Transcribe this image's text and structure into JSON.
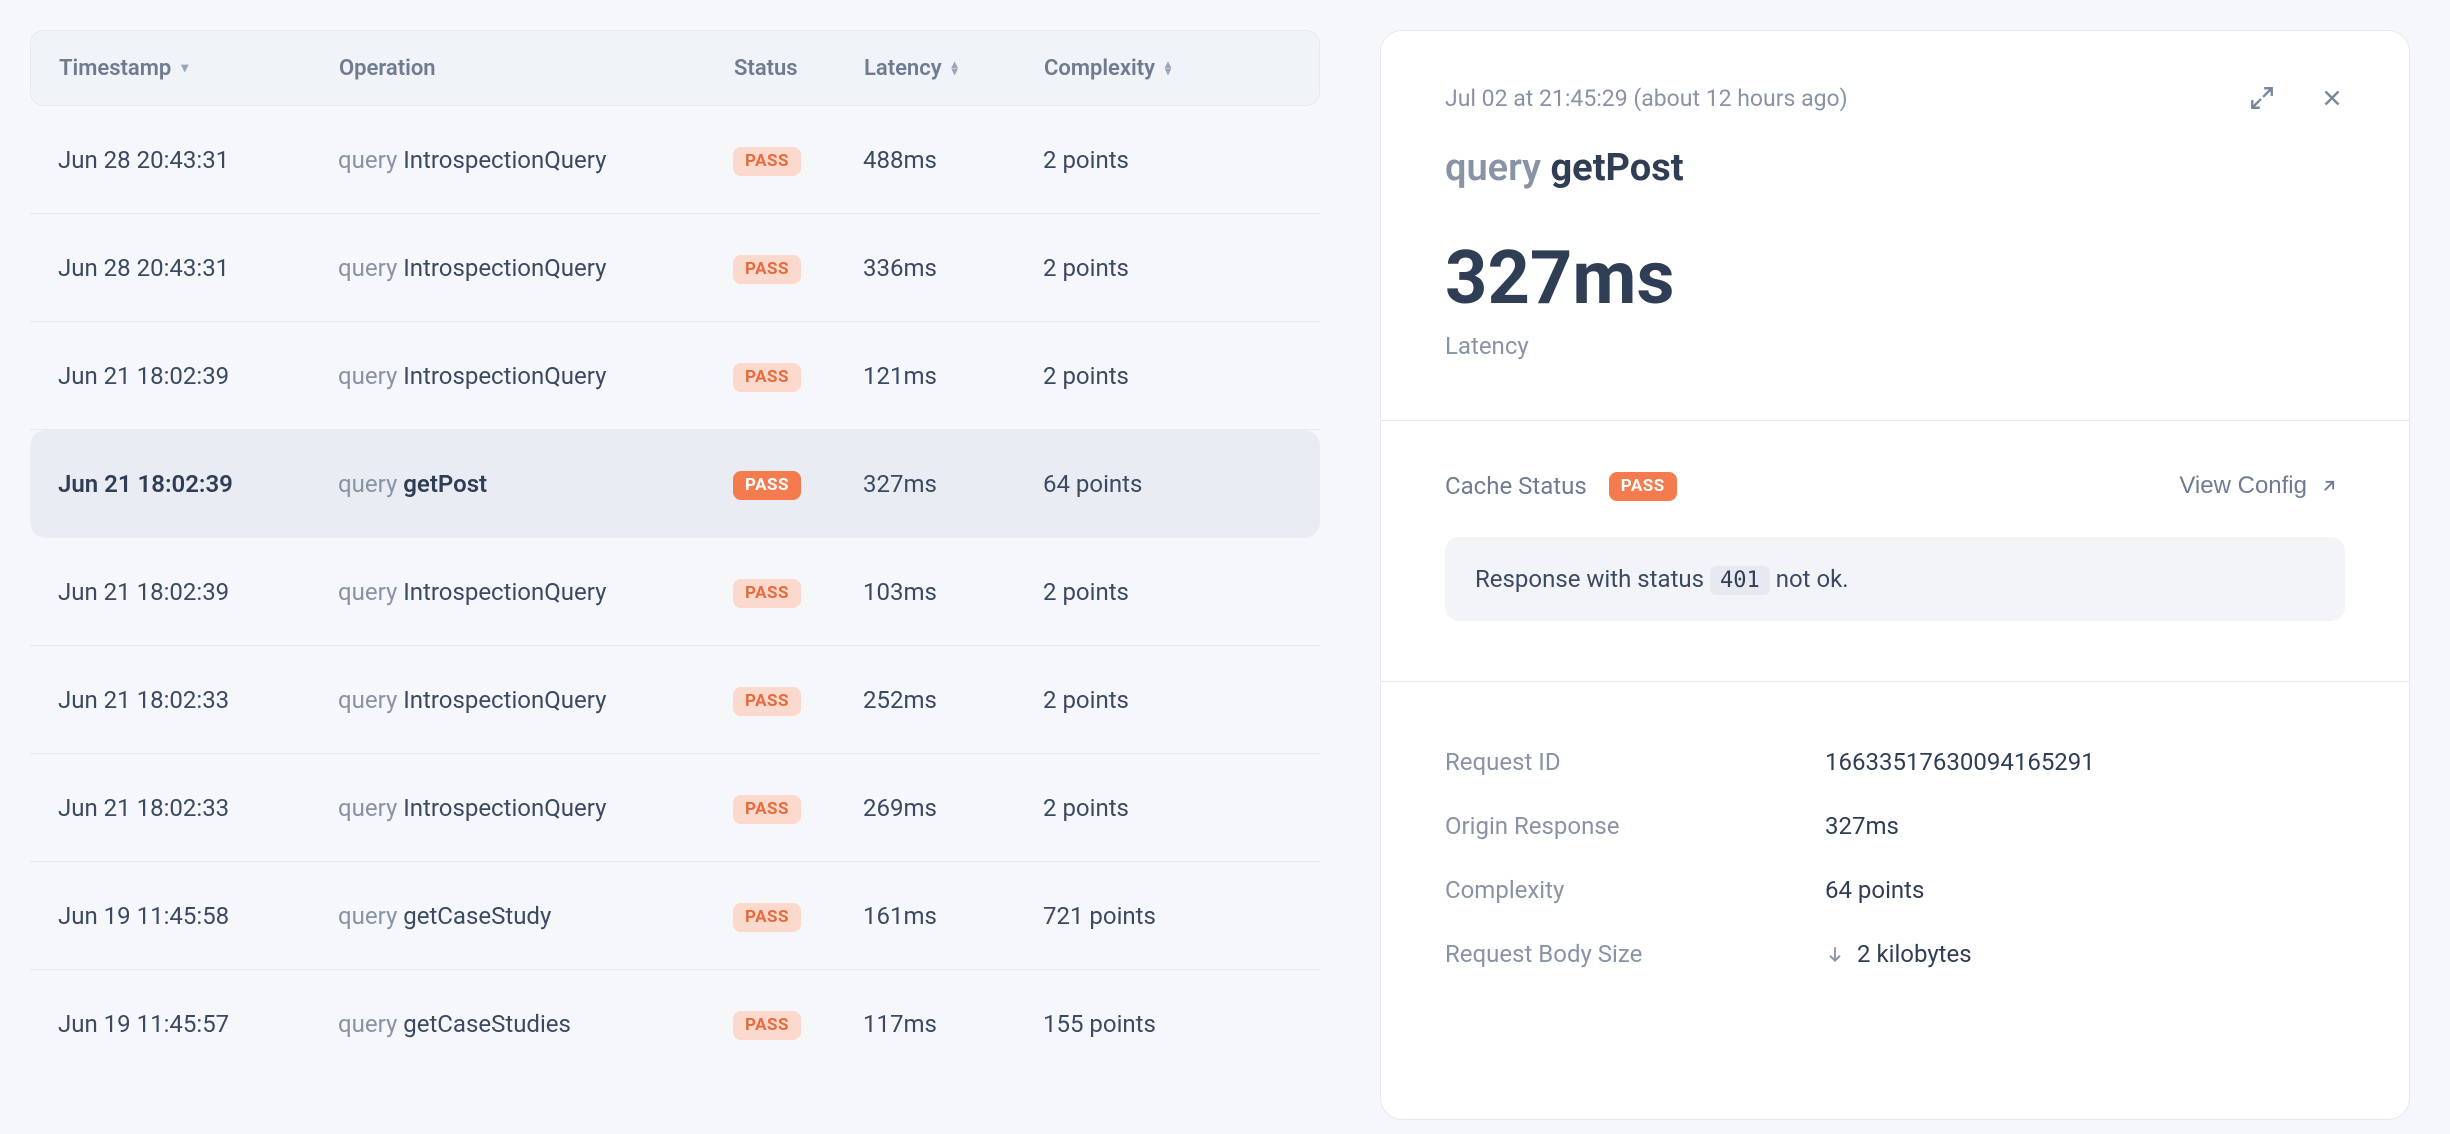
{
  "table": {
    "headers": {
      "timestamp": "Timestamp",
      "operation": "Operation",
      "status": "Status",
      "latency": "Latency",
      "complexity": "Complexity"
    },
    "rows": [
      {
        "ts": "Jun 28 20:43:31",
        "op_type": "query",
        "op_name": "IntrospectionQuery",
        "status": "PASS",
        "status_style": "light",
        "latency": "488ms",
        "complexity": "2 points",
        "selected": false
      },
      {
        "ts": "Jun 28 20:43:31",
        "op_type": "query",
        "op_name": "IntrospectionQuery",
        "status": "PASS",
        "status_style": "light",
        "latency": "336ms",
        "complexity": "2 points",
        "selected": false
      },
      {
        "ts": "Jun 21 18:02:39",
        "op_type": "query",
        "op_name": "IntrospectionQuery",
        "status": "PASS",
        "status_style": "light",
        "latency": "121ms",
        "complexity": "2 points",
        "selected": false
      },
      {
        "ts": "Jun 21 18:02:39",
        "op_type": "query",
        "op_name": "getPost",
        "status": "PASS",
        "status_style": "solid",
        "latency": "327ms",
        "complexity": "64 points",
        "selected": true
      },
      {
        "ts": "Jun 21 18:02:39",
        "op_type": "query",
        "op_name": "IntrospectionQuery",
        "status": "PASS",
        "status_style": "light",
        "latency": "103ms",
        "complexity": "2 points",
        "selected": false
      },
      {
        "ts": "Jun 21 18:02:33",
        "op_type": "query",
        "op_name": "IntrospectionQuery",
        "status": "PASS",
        "status_style": "light",
        "latency": "252ms",
        "complexity": "2 points",
        "selected": false
      },
      {
        "ts": "Jun 21 18:02:33",
        "op_type": "query",
        "op_name": "IntrospectionQuery",
        "status": "PASS",
        "status_style": "light",
        "latency": "269ms",
        "complexity": "2 points",
        "selected": false
      },
      {
        "ts": "Jun 19 11:45:58",
        "op_type": "query",
        "op_name": "getCaseStudy",
        "status": "PASS",
        "status_style": "light",
        "latency": "161ms",
        "complexity": "721 points",
        "selected": false
      },
      {
        "ts": "Jun 19 11:45:57",
        "op_type": "query",
        "op_name": "getCaseStudies",
        "status": "PASS",
        "status_style": "light",
        "latency": "117ms",
        "complexity": "155 points",
        "selected": false
      }
    ]
  },
  "detail": {
    "timestamp_line": "Jul 02 at 21:45:29 (about 12 hours ago)",
    "op_type": "query",
    "op_name": "getPost",
    "latency_value": "327ms",
    "latency_label": "Latency",
    "cache_status_label": "Cache Status",
    "cache_status_badge": "PASS",
    "view_config_label": "View Config",
    "alert_prefix": "Response with status ",
    "alert_code": "401",
    "alert_suffix": " not ok.",
    "meta": {
      "request_id": {
        "k": "Request ID",
        "v": "16633517630094165291"
      },
      "origin_response": {
        "k": "Origin Response",
        "v": "327ms"
      },
      "complexity": {
        "k": "Complexity",
        "v": "64 points"
      },
      "request_body_size": {
        "k": "Request Body Size",
        "v": "2 kilobytes"
      }
    }
  }
}
